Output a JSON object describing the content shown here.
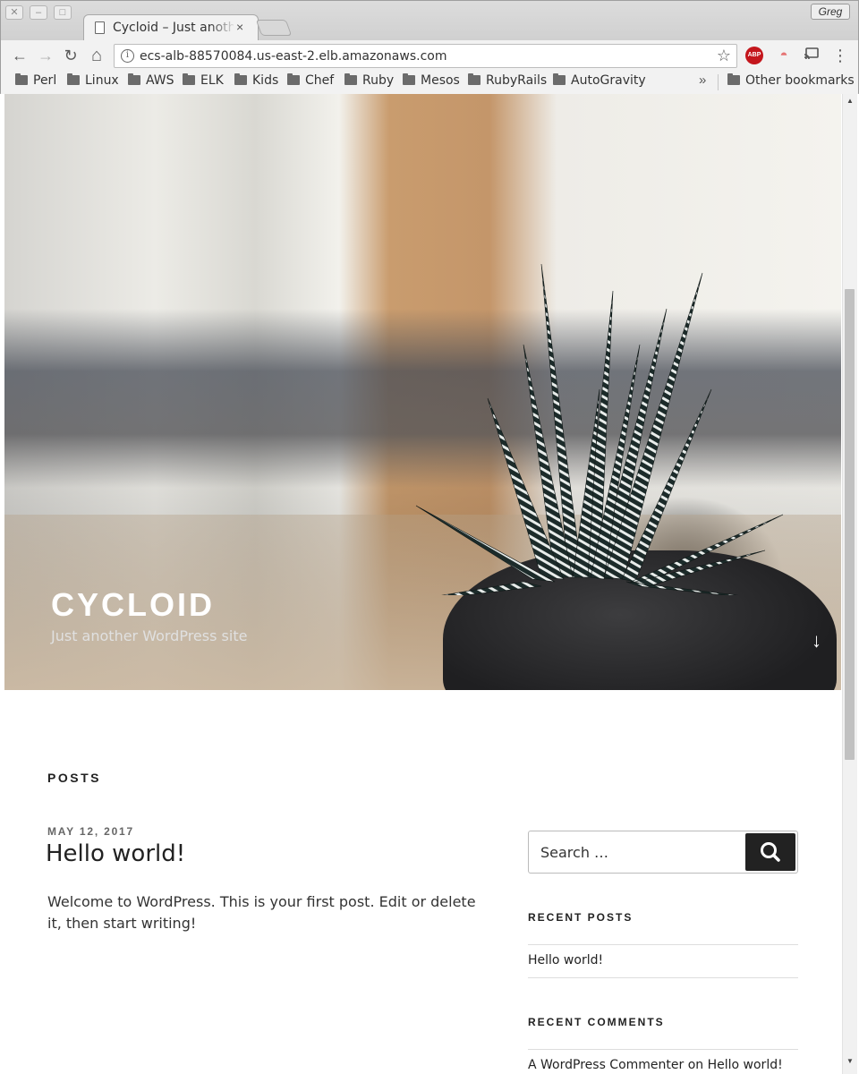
{
  "window": {
    "close_glyph": "✕",
    "minimize_glyph": "–",
    "maximize_glyph": "□",
    "profile_name": "Greg"
  },
  "tab": {
    "title": "Cycloid – Just another WordPress site",
    "close_glyph": "×"
  },
  "toolbar": {
    "back_glyph": "←",
    "forward_glyph": "→",
    "reload_glyph": "↻",
    "home_glyph": "⌂",
    "url": "ecs-alb-88570084.us-east-2.elb.amazonaws.com",
    "info_glyph": "i",
    "star_glyph": "☆",
    "abp_label": "ABP",
    "menu_glyph": "⋮"
  },
  "bookmarks": {
    "items": [
      "Perl",
      "Linux",
      "AWS",
      "ELK",
      "Kids",
      "Chef",
      "Ruby",
      "Mesos",
      "RubyRails",
      "AutoGravity"
    ],
    "more_glyph": "»",
    "other": "Other bookmarks"
  },
  "site": {
    "title": "CYCLOID",
    "description": "Just another WordPress site",
    "scroll_glyph": "↓"
  },
  "posts": {
    "heading": "POSTS",
    "items": [
      {
        "date": "MAY 12, 2017",
        "title": "Hello world!",
        "excerpt": "Welcome to WordPress. This is your first post. Edit or delete it, then start writing!"
      }
    ]
  },
  "sidebar": {
    "search_placeholder": "Search …",
    "recent_posts_title": "RECENT POSTS",
    "recent_posts": [
      "Hello world!"
    ],
    "recent_comments_title": "RECENT COMMENTS",
    "recent_comment": "A WordPress Commenter on Hello world!"
  },
  "colors": {
    "accent_dark": "#222222",
    "abp_red": "#c4161c"
  }
}
